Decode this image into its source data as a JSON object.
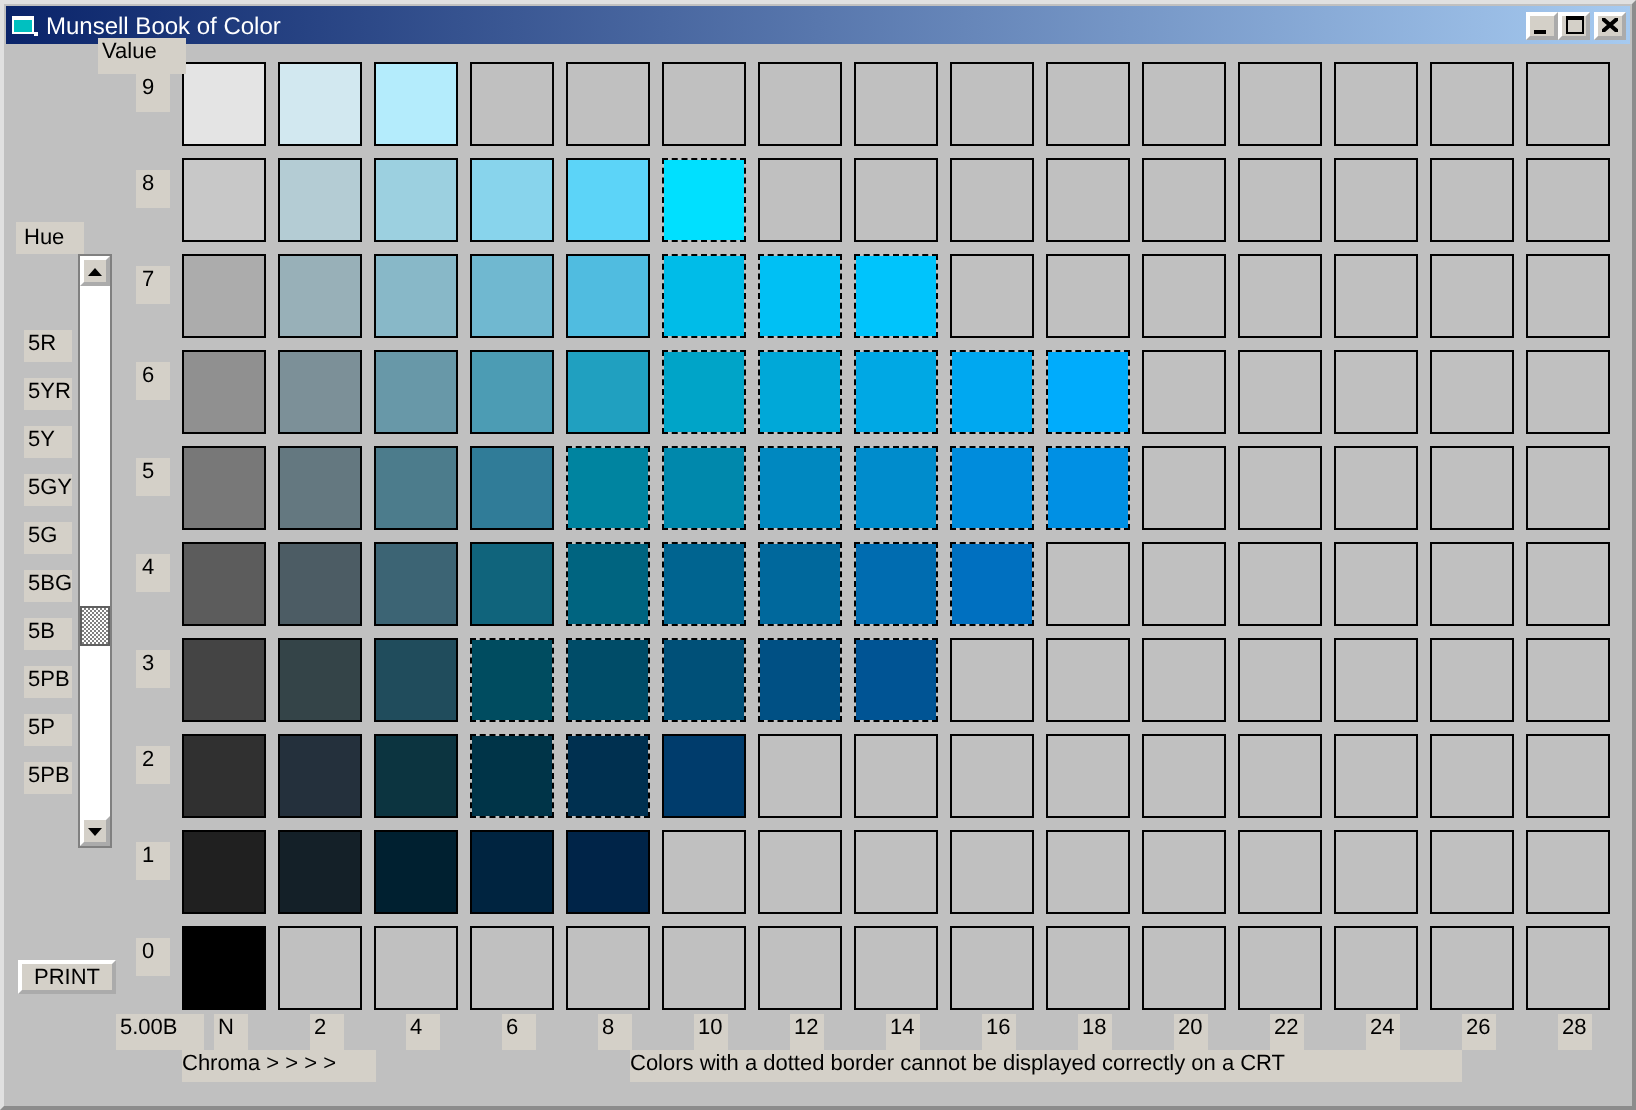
{
  "window": {
    "title": "Munsell Book of Color"
  },
  "hue": {
    "label": "Hue",
    "hues": [
      "5R",
      "5YR",
      "5Y",
      "5GY",
      "5G",
      "5BG",
      "5B",
      "5PB",
      "5P",
      "5PB"
    ]
  },
  "print_button": "PRINT",
  "value_header": "Value",
  "rows": [
    {
      "value": "9",
      "cells": [
        {
          "color": "#e4e4e4",
          "dotted": false
        },
        {
          "color": "#d2e8f0",
          "dotted": false
        },
        {
          "color": "#b4ecfc",
          "dotted": false
        },
        {
          "color": "#c0c0c0",
          "dotted": false
        },
        {
          "color": "#c0c0c0",
          "dotted": false
        },
        {
          "color": "#c0c0c0",
          "dotted": false
        },
        {
          "color": "#c0c0c0",
          "dotted": false
        },
        {
          "color": "#c0c0c0",
          "dotted": false
        },
        {
          "color": "#c0c0c0",
          "dotted": false
        },
        {
          "color": "#c0c0c0",
          "dotted": false
        },
        {
          "color": "#c0c0c0",
          "dotted": false
        },
        {
          "color": "#c0c0c0",
          "dotted": false
        },
        {
          "color": "#c0c0c0",
          "dotted": false
        },
        {
          "color": "#c0c0c0",
          "dotted": false
        },
        {
          "color": "#c0c0c0",
          "dotted": false
        }
      ]
    },
    {
      "value": "8",
      "cells": [
        {
          "color": "#c8c8c8",
          "dotted": false
        },
        {
          "color": "#b4ccd4",
          "dotted": false
        },
        {
          "color": "#9cd0e0",
          "dotted": false
        },
        {
          "color": "#88d4ec",
          "dotted": false
        },
        {
          "color": "#5cd4f8",
          "dotted": false
        },
        {
          "color": "#00e0ff",
          "dotted": true
        },
        {
          "color": "#c0c0c0",
          "dotted": false
        },
        {
          "color": "#c0c0c0",
          "dotted": false
        },
        {
          "color": "#c0c0c0",
          "dotted": false
        },
        {
          "color": "#c0c0c0",
          "dotted": false
        },
        {
          "color": "#c0c0c0",
          "dotted": false
        },
        {
          "color": "#c0c0c0",
          "dotted": false
        },
        {
          "color": "#c0c0c0",
          "dotted": false
        },
        {
          "color": "#c0c0c0",
          "dotted": false
        },
        {
          "color": "#c0c0c0",
          "dotted": false
        }
      ]
    },
    {
      "value": "7",
      "cells": [
        {
          "color": "#acacac",
          "dotted": false
        },
        {
          "color": "#98b0b8",
          "dotted": false
        },
        {
          "color": "#88b8c8",
          "dotted": false
        },
        {
          "color": "#70b8d0",
          "dotted": false
        },
        {
          "color": "#50bce0",
          "dotted": false
        },
        {
          "color": "#00bce8",
          "dotted": true
        },
        {
          "color": "#00c0f4",
          "dotted": true
        },
        {
          "color": "#00c4fc",
          "dotted": true
        },
        {
          "color": "#c0c0c0",
          "dotted": false
        },
        {
          "color": "#c0c0c0",
          "dotted": false
        },
        {
          "color": "#c0c0c0",
          "dotted": false
        },
        {
          "color": "#c0c0c0",
          "dotted": false
        },
        {
          "color": "#c0c0c0",
          "dotted": false
        },
        {
          "color": "#c0c0c0",
          "dotted": false
        },
        {
          "color": "#c0c0c0",
          "dotted": false
        }
      ]
    },
    {
      "value": "6",
      "cells": [
        {
          "color": "#909090",
          "dotted": false
        },
        {
          "color": "#7c9098",
          "dotted": false
        },
        {
          "color": "#6898a8",
          "dotted": false
        },
        {
          "color": "#4c9cb4",
          "dotted": false
        },
        {
          "color": "#20a0c0",
          "dotted": false
        },
        {
          "color": "#00a4c8",
          "dotted": true
        },
        {
          "color": "#00a8d8",
          "dotted": true
        },
        {
          "color": "#00a8e4",
          "dotted": true
        },
        {
          "color": "#00a8f0",
          "dotted": true
        },
        {
          "color": "#00acfc",
          "dotted": true
        },
        {
          "color": "#c0c0c0",
          "dotted": false
        },
        {
          "color": "#c0c0c0",
          "dotted": false
        },
        {
          "color": "#c0c0c0",
          "dotted": false
        },
        {
          "color": "#c0c0c0",
          "dotted": false
        },
        {
          "color": "#c0c0c0",
          "dotted": false
        }
      ]
    },
    {
      "value": "5",
      "cells": [
        {
          "color": "#787878",
          "dotted": false
        },
        {
          "color": "#647880",
          "dotted": false
        },
        {
          "color": "#4c7c8c",
          "dotted": false
        },
        {
          "color": "#307c98",
          "dotted": false
        },
        {
          "color": "#0084a0",
          "dotted": true
        },
        {
          "color": "#0088ac",
          "dotted": true
        },
        {
          "color": "#0088c0",
          "dotted": true
        },
        {
          "color": "#008ccc",
          "dotted": true
        },
        {
          "color": "#008cdc",
          "dotted": true
        },
        {
          "color": "#0090e4",
          "dotted": true
        },
        {
          "color": "#c0c0c0",
          "dotted": false
        },
        {
          "color": "#c0c0c0",
          "dotted": false
        },
        {
          "color": "#c0c0c0",
          "dotted": false
        },
        {
          "color": "#c0c0c0",
          "dotted": false
        },
        {
          "color": "#c0c0c0",
          "dotted": false
        }
      ]
    },
    {
      "value": "4",
      "cells": [
        {
          "color": "#5c5c5c",
          "dotted": false
        },
        {
          "color": "#4c5c64",
          "dotted": false
        },
        {
          "color": "#3c6474",
          "dotted": false
        },
        {
          "color": "#10647c",
          "dotted": false
        },
        {
          "color": "#006480",
          "dotted": true
        },
        {
          "color": "#006490",
          "dotted": true
        },
        {
          "color": "#00689c",
          "dotted": true
        },
        {
          "color": "#006cb0",
          "dotted": true
        },
        {
          "color": "#0070c0",
          "dotted": true
        },
        {
          "color": "#c0c0c0",
          "dotted": false
        },
        {
          "color": "#c0c0c0",
          "dotted": false
        },
        {
          "color": "#c0c0c0",
          "dotted": false
        },
        {
          "color": "#c0c0c0",
          "dotted": false
        },
        {
          "color": "#c0c0c0",
          "dotted": false
        },
        {
          "color": "#c0c0c0",
          "dotted": false
        }
      ]
    },
    {
      "value": "3",
      "cells": [
        {
          "color": "#444444",
          "dotted": false
        },
        {
          "color": "#344448",
          "dotted": false
        },
        {
          "color": "#204c5c",
          "dotted": false
        },
        {
          "color": "#004c60",
          "dotted": true
        },
        {
          "color": "#004c68",
          "dotted": true
        },
        {
          "color": "#005078",
          "dotted": true
        },
        {
          "color": "#005084",
          "dotted": true
        },
        {
          "color": "#005494",
          "dotted": true
        },
        {
          "color": "#c0c0c0",
          "dotted": false
        },
        {
          "color": "#c0c0c0",
          "dotted": false
        },
        {
          "color": "#c0c0c0",
          "dotted": false
        },
        {
          "color": "#c0c0c0",
          "dotted": false
        },
        {
          "color": "#c0c0c0",
          "dotted": false
        },
        {
          "color": "#c0c0c0",
          "dotted": false
        },
        {
          "color": "#c0c0c0",
          "dotted": false
        }
      ]
    },
    {
      "value": "2",
      "cells": [
        {
          "color": "#303030",
          "dotted": false
        },
        {
          "color": "#24303c",
          "dotted": false
        },
        {
          "color": "#0c3440",
          "dotted": false
        },
        {
          "color": "#003448",
          "dotted": true
        },
        {
          "color": "#003050",
          "dotted": true
        },
        {
          "color": "#003c6c",
          "dotted": false
        },
        {
          "color": "#c0c0c0",
          "dotted": false
        },
        {
          "color": "#c0c0c0",
          "dotted": false
        },
        {
          "color": "#c0c0c0",
          "dotted": false
        },
        {
          "color": "#c0c0c0",
          "dotted": false
        },
        {
          "color": "#c0c0c0",
          "dotted": false
        },
        {
          "color": "#c0c0c0",
          "dotted": false
        },
        {
          "color": "#c0c0c0",
          "dotted": false
        },
        {
          "color": "#c0c0c0",
          "dotted": false
        },
        {
          "color": "#c0c0c0",
          "dotted": false
        }
      ]
    },
    {
      "value": "1",
      "cells": [
        {
          "color": "#202020",
          "dotted": false
        },
        {
          "color": "#142028",
          "dotted": false
        },
        {
          "color": "#002030",
          "dotted": false
        },
        {
          "color": "#002440",
          "dotted": false
        },
        {
          "color": "#002448",
          "dotted": false
        },
        {
          "color": "#c0c0c0",
          "dotted": false
        },
        {
          "color": "#c0c0c0",
          "dotted": false
        },
        {
          "color": "#c0c0c0",
          "dotted": false
        },
        {
          "color": "#c0c0c0",
          "dotted": false
        },
        {
          "color": "#c0c0c0",
          "dotted": false
        },
        {
          "color": "#c0c0c0",
          "dotted": false
        },
        {
          "color": "#c0c0c0",
          "dotted": false
        },
        {
          "color": "#c0c0c0",
          "dotted": false
        },
        {
          "color": "#c0c0c0",
          "dotted": false
        },
        {
          "color": "#c0c0c0",
          "dotted": false
        }
      ]
    },
    {
      "value": "0",
      "cells": [
        {
          "color": "#000000",
          "dotted": false
        },
        {
          "color": "#c0c0c0",
          "dotted": false
        },
        {
          "color": "#c0c0c0",
          "dotted": false
        },
        {
          "color": "#c0c0c0",
          "dotted": false
        },
        {
          "color": "#c0c0c0",
          "dotted": false
        },
        {
          "color": "#c0c0c0",
          "dotted": false
        },
        {
          "color": "#c0c0c0",
          "dotted": false
        },
        {
          "color": "#c0c0c0",
          "dotted": false
        },
        {
          "color": "#c0c0c0",
          "dotted": false
        },
        {
          "color": "#c0c0c0",
          "dotted": false
        },
        {
          "color": "#c0c0c0",
          "dotted": false
        },
        {
          "color": "#c0c0c0",
          "dotted": false
        },
        {
          "color": "#c0c0c0",
          "dotted": false
        },
        {
          "color": "#c0c0c0",
          "dotted": false
        },
        {
          "color": "#c0c0c0",
          "dotted": false
        }
      ]
    }
  ],
  "hue_code": "5.00B",
  "chroma_labels": [
    "N",
    "2",
    "4",
    "6",
    "8",
    "10",
    "12",
    "14",
    "16",
    "18",
    "20",
    "22",
    "24",
    "26",
    "28"
  ],
  "chroma_caption": "Chroma > > > >",
  "note": "Colors with a dotted border cannot be displayed correctly on a CRT"
}
